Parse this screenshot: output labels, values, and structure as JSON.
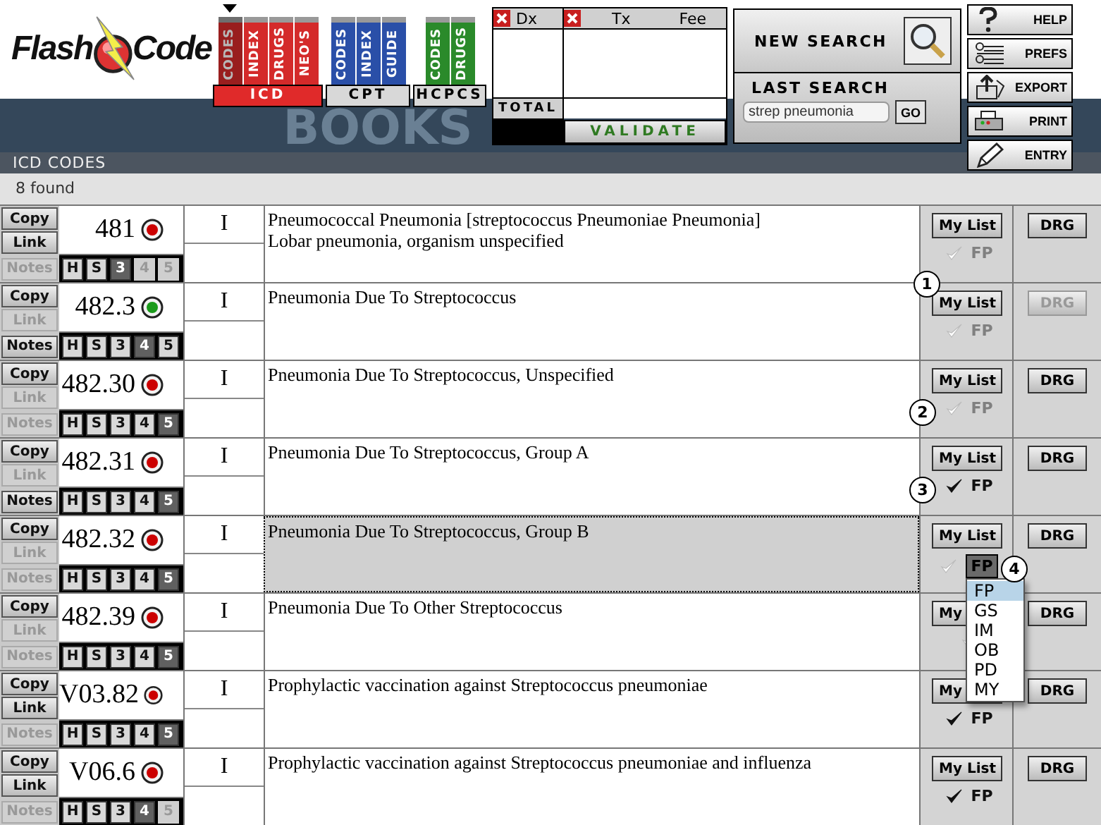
{
  "logo": {
    "word_1": "Flash",
    "word_2": "Code"
  },
  "book_groups": [
    {
      "label": "ICD",
      "selected": true,
      "color": "#d42a2a",
      "books": [
        {
          "label": "CODES",
          "selected": true
        },
        {
          "label": "INDEX",
          "selected": false
        },
        {
          "label": "DRUGS",
          "selected": false
        },
        {
          "label": "NEO'S",
          "selected": false
        }
      ]
    },
    {
      "label": "CPT",
      "selected": false,
      "color": "#2a4fa8",
      "books": [
        {
          "label": "CODES",
          "selected": false
        },
        {
          "label": "INDEX",
          "selected": false
        },
        {
          "label": "GUIDE",
          "selected": false
        }
      ]
    },
    {
      "label": "HCPCS",
      "selected": false,
      "color": "#2a8a2a",
      "books": [
        {
          "label": "CODES",
          "selected": false
        },
        {
          "label": "DRUGS",
          "selected": false
        }
      ]
    }
  ],
  "books_caption": "BOOKS",
  "fee_panel": {
    "dx_label": "Dx",
    "tx_label": "Tx",
    "fee_label": "Fee",
    "total_label": "TOTAL",
    "validate_label": "VALIDATE"
  },
  "search": {
    "new_search_label": "NEW SEARCH",
    "last_search_label": "LAST SEARCH",
    "value": "strep pneumonia",
    "go_label": "GO"
  },
  "tool_buttons": [
    {
      "kind": "help",
      "label": "HELP"
    },
    {
      "kind": "prefs",
      "label": "PREFS"
    },
    {
      "kind": "export",
      "label": "EXPORT"
    },
    {
      "kind": "print",
      "label": "PRINT"
    },
    {
      "kind": "entry",
      "label": "ENTRY"
    }
  ],
  "section_title": "ICD CODES",
  "result_count": "8 found",
  "rows": [
    {
      "copy": "Copy",
      "link": "Link",
      "link_disabled": false,
      "notes": "Notes",
      "notes_disabled": true,
      "levels": [
        {
          "label": "H",
          "selected": false,
          "disabled": false
        },
        {
          "label": "S",
          "selected": false,
          "disabled": false
        },
        {
          "label": "3",
          "selected": true,
          "disabled": false
        },
        {
          "label": "4",
          "selected": false,
          "disabled": true
        },
        {
          "label": "5",
          "selected": false,
          "disabled": true
        }
      ],
      "code": "481",
      "color": "#cc0000",
      "type": "I",
      "descriptions": [
        "Pneumococcal Pneumonia [streptococcus Pneumoniae Pneumonia]",
        "Lobar pneumonia, organism unspecified"
      ],
      "selected": false,
      "my_list": "My List",
      "drg": "DRG",
      "drg_disabled": false,
      "specialty": "FP",
      "specialty_checked": false
    },
    {
      "copy": "Copy",
      "link": "Link",
      "link_disabled": true,
      "notes": "Notes",
      "notes_disabled": false,
      "levels": [
        {
          "label": "H",
          "selected": false,
          "disabled": false
        },
        {
          "label": "S",
          "selected": false,
          "disabled": false
        },
        {
          "label": "3",
          "selected": false,
          "disabled": false
        },
        {
          "label": "4",
          "selected": true,
          "disabled": false
        },
        {
          "label": "5",
          "selected": false,
          "disabled": false
        }
      ],
      "code": "482.3",
      "color": "#1a9a1a",
      "type": "I",
      "descriptions": [
        "Pneumonia Due To Streptococcus"
      ],
      "selected": false,
      "my_list": "My List",
      "drg": "DRG",
      "drg_disabled": true,
      "specialty": "FP",
      "specialty_checked": false,
      "callout": {
        "label": "1",
        "kind": "list_button"
      }
    },
    {
      "copy": "Copy",
      "link": "Link",
      "link_disabled": true,
      "notes": "Notes",
      "notes_disabled": true,
      "levels": [
        {
          "label": "H",
          "selected": false,
          "disabled": false
        },
        {
          "label": "S",
          "selected": false,
          "disabled": false
        },
        {
          "label": "3",
          "selected": false,
          "disabled": false
        },
        {
          "label": "4",
          "selected": false,
          "disabled": false
        },
        {
          "label": "5",
          "selected": true,
          "disabled": false
        }
      ],
      "code": "482.30",
      "color": "#cc0000",
      "type": "I",
      "descriptions": [
        "Pneumonia Due To Streptococcus, Unspecified"
      ],
      "selected": false,
      "my_list": "My List",
      "drg": "DRG",
      "drg_disabled": false,
      "specialty": "FP",
      "specialty_checked": false,
      "callout": {
        "label": "2",
        "kind": "check"
      }
    },
    {
      "copy": "Copy",
      "link": "Link",
      "link_disabled": true,
      "notes": "Notes",
      "notes_disabled": false,
      "levels": [
        {
          "label": "H",
          "selected": false,
          "disabled": false
        },
        {
          "label": "S",
          "selected": false,
          "disabled": false
        },
        {
          "label": "3",
          "selected": false,
          "disabled": false
        },
        {
          "label": "4",
          "selected": false,
          "disabled": false
        },
        {
          "label": "5",
          "selected": true,
          "disabled": false
        }
      ],
      "code": "482.31",
      "color": "#cc0000",
      "type": "I",
      "descriptions": [
        "Pneumonia Due To Streptococcus, Group A"
      ],
      "selected": false,
      "my_list": "My List",
      "drg": "DRG",
      "drg_disabled": false,
      "specialty": "FP",
      "specialty_checked": true,
      "callout": {
        "label": "3",
        "kind": "check"
      }
    },
    {
      "copy": "Copy",
      "link": "Link",
      "link_disabled": true,
      "notes": "Notes",
      "notes_disabled": true,
      "levels": [
        {
          "label": "H",
          "selected": false,
          "disabled": false
        },
        {
          "label": "S",
          "selected": false,
          "disabled": false
        },
        {
          "label": "3",
          "selected": false,
          "disabled": false
        },
        {
          "label": "4",
          "selected": false,
          "disabled": false
        },
        {
          "label": "5",
          "selected": true,
          "disabled": false
        }
      ],
      "code": "482.32",
      "color": "#cc0000",
      "type": "I",
      "descriptions": [
        "Pneumonia Due To Streptococcus, Group B"
      ],
      "selected": true,
      "my_list": "My List",
      "drg": "DRG",
      "drg_disabled": false,
      "specialty": "FP",
      "specialty_checked": false,
      "specialty_open": true,
      "menu": [
        {
          "label": "FP",
          "selected": true
        },
        {
          "label": "GS",
          "selected": false
        },
        {
          "label": "IM",
          "selected": false
        },
        {
          "label": "OB",
          "selected": false
        },
        {
          "label": "PD",
          "selected": false
        },
        {
          "label": "MY",
          "selected": false
        }
      ],
      "callout": {
        "label": "4",
        "kind": "menu"
      }
    },
    {
      "copy": "Copy",
      "link": "Link",
      "link_disabled": true,
      "notes": "Notes",
      "notes_disabled": true,
      "levels": [
        {
          "label": "H",
          "selected": false,
          "disabled": false
        },
        {
          "label": "S",
          "selected": false,
          "disabled": false
        },
        {
          "label": "3",
          "selected": false,
          "disabled": false
        },
        {
          "label": "4",
          "selected": false,
          "disabled": false
        },
        {
          "label": "5",
          "selected": true,
          "disabled": false
        }
      ],
      "code": "482.39",
      "color": "#cc0000",
      "type": "I",
      "descriptions": [
        "Pneumonia Due To Other Streptococcus"
      ],
      "selected": false,
      "my_list": "My",
      "drg": "DRG",
      "drg_disabled": false,
      "specialty_checked": false
    },
    {
      "copy": "Copy",
      "link": "Link",
      "link_disabled": false,
      "notes": "Notes",
      "notes_disabled": true,
      "levels": [
        {
          "label": "H",
          "selected": false,
          "disabled": false
        },
        {
          "label": "S",
          "selected": false,
          "disabled": false
        },
        {
          "label": "3",
          "selected": false,
          "disabled": false
        },
        {
          "label": "4",
          "selected": false,
          "disabled": false
        },
        {
          "label": "5",
          "selected": true,
          "disabled": false
        }
      ],
      "code": "V03.82",
      "color": "#cc0000",
      "type": "I",
      "descriptions": [
        "Prophylactic vaccination against Streptococcus pneumoniae"
      ],
      "selected": false,
      "my_list": "My",
      "drg": "DRG",
      "drg_disabled": false,
      "specialty": "FP",
      "specialty_checked": true
    },
    {
      "copy": "Copy",
      "link": "Link",
      "link_disabled": false,
      "notes": "Notes",
      "notes_disabled": true,
      "levels": [
        {
          "label": "H",
          "selected": false,
          "disabled": false
        },
        {
          "label": "S",
          "selected": false,
          "disabled": false
        },
        {
          "label": "3",
          "selected": false,
          "disabled": false
        },
        {
          "label": "4",
          "selected": true,
          "disabled": false
        },
        {
          "label": "5",
          "selected": false,
          "disabled": true
        }
      ],
      "code": "V06.6",
      "color": "#cc0000",
      "type": "I",
      "descriptions": [
        "Prophylactic vaccination against Streptococcus pneumoniae and influenza"
      ],
      "selected": false,
      "my_list": "My List",
      "drg": "DRG",
      "drg_disabled": false,
      "specialty": "FP",
      "specialty_checked": true
    }
  ]
}
